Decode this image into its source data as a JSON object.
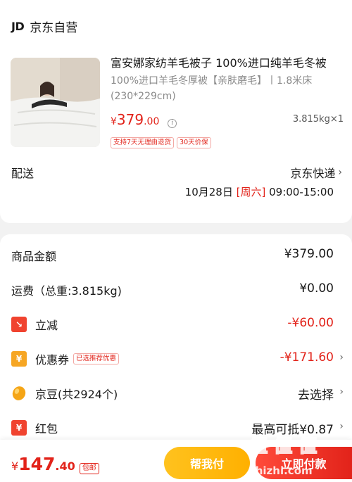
{
  "shop": {
    "logo": "JD",
    "name": "京东自营"
  },
  "product": {
    "title": "富安娜家纺羊毛被子 100%进口纯羊毛冬被",
    "spec": "100%进口羊毛冬厚被【亲肤磨毛】丨1.8米床(230*229cm)",
    "price_currency": "¥",
    "price_int": "379",
    "price_dec": ".00",
    "weight_qty": "3.815kg×1",
    "tags": [
      "支持7天无理由退货",
      "30天价保"
    ]
  },
  "shipping": {
    "label": "配送",
    "method": "京东快递",
    "date": "10月28日",
    "weekday": "[周六]",
    "time": "09:00-15:00"
  },
  "summary": {
    "goods_amount": {
      "label": "商品金额",
      "value": "¥379.00"
    },
    "freight": {
      "label": "运费（总重:3.815kg)",
      "value": "¥0.00"
    },
    "lijian": {
      "label": "立减",
      "value": "-¥60.00"
    },
    "coupon": {
      "label": "优惠券",
      "badge": "已选推荐优惠",
      "value": "-¥171.60"
    },
    "jingdou": {
      "label": "京豆(共2924个)",
      "value": "去选择"
    },
    "hongbao": {
      "label": "红包",
      "value": "最高可抵¥0.87"
    }
  },
  "footer": {
    "currency": "¥",
    "total_int": "147",
    "total_dec": ".40",
    "ship_badge": "包邮",
    "help_pay": "帮我付",
    "pay": "立即付款"
  },
  "watermark": {
    "logo": "值 值 值",
    "domain": "zhizhi.com"
  },
  "colors": {
    "accent_red": "#e2231a",
    "help_yellow": "#ffb000"
  }
}
